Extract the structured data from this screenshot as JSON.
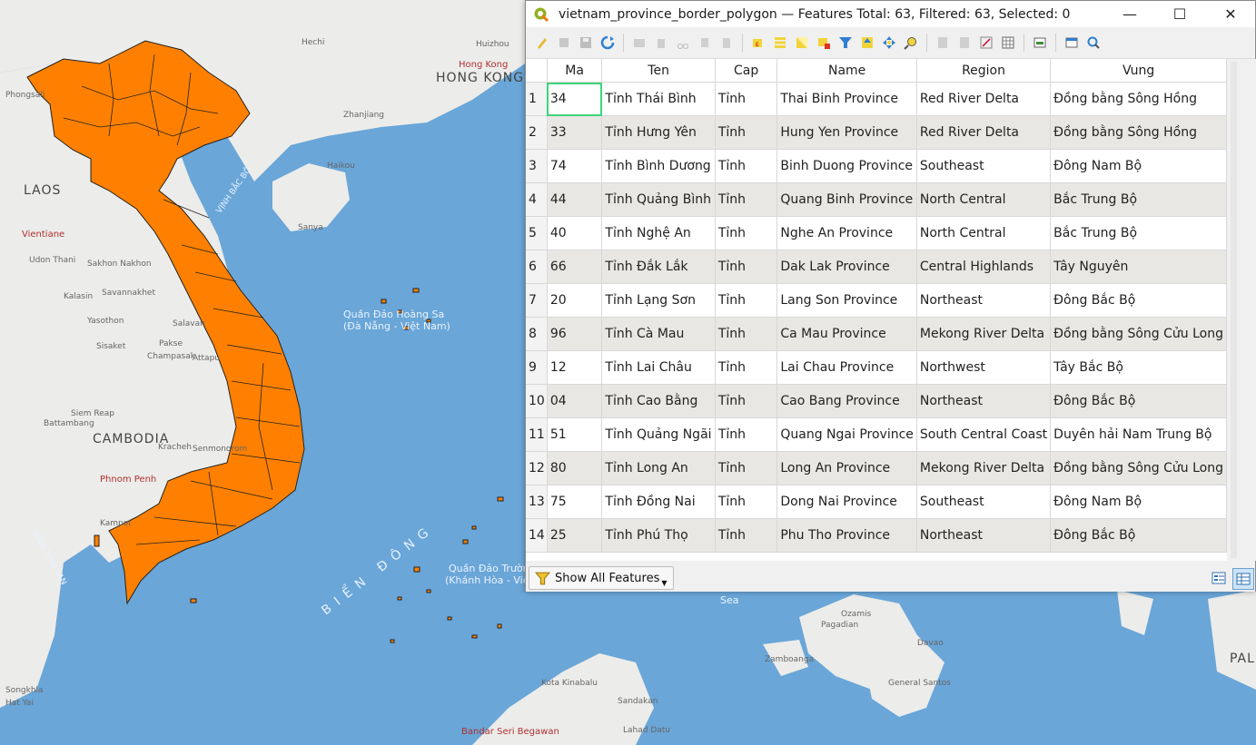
{
  "map": {
    "labels": {
      "laos": "LAOS",
      "cambodia": "CAMBODIA",
      "hong_kong": "HONG KONG",
      "vientiane": "Vientiane",
      "phnom_penh": "Phnom Penh",
      "hong_kong_small": "Hong Kong",
      "bandar": "Bandar Seri Begawan",
      "paracel": "Quần Đảo Hoàng Sa",
      "paracel_sub": "(Đà Nẵng - Việt Nam)",
      "spratly": "Quần Đảo Trường Sa",
      "spratly_sub": "(Khánh Hòa - Việt Nam)",
      "bien_dong": "BIỂN ĐÔNG",
      "vinh_bac_bo": "VỊNH BẮC BỘ",
      "vinh_thai_lan": "VỊNH THÁI LAN",
      "sea": "Sea",
      "pal": "PAL",
      "udon": "Udon Thani",
      "sakhon": "Sakhon Nakhon",
      "kalasin": "Kalasin",
      "savannakhet": "Savannakhet",
      "yasothon": "Yasothon",
      "sisaket": "Sisaket",
      "pakse": "Pakse",
      "champasak": "Champasak",
      "attapu": "Attapu",
      "salavan": "Salavan",
      "siem_reap": "Siem Reap",
      "battambang": "Battambang",
      "kracheh": "Kracheh",
      "senmonorom": "Senmonorom",
      "kampot": "Kampot",
      "phongsali": "Phongsali",
      "hechi": "Hechi",
      "huizhou": "Huizhou",
      "haikou": "Haikou",
      "sanya": "Sanya",
      "zhanjiang": "Zhanjiang",
      "zamboanga": "Zamboanga",
      "general_santos": "General Santos",
      "pagadian": "Pagadian",
      "ozamis": "Ozamis",
      "davao": "Davao",
      "kota_kinabalu": "Kota Kinabalu",
      "lahad_datu": "Lahad Datu",
      "sandakan": "Sandakan",
      "songkhla": "Songkhla",
      "hat_yai": "Hat Yai"
    }
  },
  "window": {
    "title": "vietnam_province_border_polygon — Features Total: 63, Filtered: 63, Selected: 0",
    "minimize": "—",
    "maximize": "☐",
    "close": "✕"
  },
  "table": {
    "columns": [
      "Ma",
      "Ten",
      "Cap",
      "Name",
      "Region",
      "Vung"
    ],
    "rows": [
      {
        "n": "1",
        "Ma": "34",
        "Ten": "Tỉnh Thái Bình",
        "Cap": "Tỉnh",
        "Name": "Thai Binh Province",
        "Region": "Red River Delta",
        "Vung": "Đồng bằng Sông Hồng"
      },
      {
        "n": "2",
        "Ma": "33",
        "Ten": "Tỉnh Hưng Yên",
        "Cap": "Tỉnh",
        "Name": "Hung Yen Province",
        "Region": "Red River Delta",
        "Vung": "Đồng bằng Sông Hồng"
      },
      {
        "n": "3",
        "Ma": "74",
        "Ten": "Tỉnh Bình Dương",
        "Cap": "Tỉnh",
        "Name": "Binh Duong Province",
        "Region": "Southeast",
        "Vung": "Đông Nam Bộ"
      },
      {
        "n": "4",
        "Ma": "44",
        "Ten": "Tỉnh Quảng Bình",
        "Cap": "Tỉnh",
        "Name": "Quang Binh Province",
        "Region": "North Central",
        "Vung": "Bắc Trung Bộ"
      },
      {
        "n": "5",
        "Ma": "40",
        "Ten": "Tỉnh Nghệ An",
        "Cap": "Tỉnh",
        "Name": "Nghe An Province",
        "Region": "North Central",
        "Vung": "Bắc Trung Bộ"
      },
      {
        "n": "6",
        "Ma": "66",
        "Ten": "Tỉnh Đắk Lắk",
        "Cap": "Tỉnh",
        "Name": "Dak Lak Province",
        "Region": "Central Highlands",
        "Vung": "Tây Nguyên"
      },
      {
        "n": "7",
        "Ma": "20",
        "Ten": "Tỉnh Lạng Sơn",
        "Cap": "Tỉnh",
        "Name": "Lang Son Province",
        "Region": "Northeast",
        "Vung": "Đông Bắc Bộ"
      },
      {
        "n": "8",
        "Ma": "96",
        "Ten": "Tỉnh Cà Mau",
        "Cap": "Tỉnh",
        "Name": "Ca Mau Province",
        "Region": "Mekong River Delta",
        "Vung": "Đồng bằng Sông Cửu Long"
      },
      {
        "n": "9",
        "Ma": "12",
        "Ten": "Tỉnh Lai Châu",
        "Cap": "Tỉnh",
        "Name": "Lai Chau Province",
        "Region": "Northwest",
        "Vung": "Tây Bắc Bộ"
      },
      {
        "n": "10",
        "Ma": "04",
        "Ten": "Tỉnh Cao Bằng",
        "Cap": "Tỉnh",
        "Name": "Cao Bang Province",
        "Region": "Northeast",
        "Vung": "Đông Bắc Bộ"
      },
      {
        "n": "11",
        "Ma": "51",
        "Ten": "Tỉnh Quảng Ngãi",
        "Cap": "Tỉnh",
        "Name": "Quang Ngai Province",
        "Region": "South Central Coast",
        "Vung": "Duyên hải Nam Trung Bộ"
      },
      {
        "n": "12",
        "Ma": "80",
        "Ten": "Tỉnh Long An",
        "Cap": "Tỉnh",
        "Name": "Long An Province",
        "Region": "Mekong River Delta",
        "Vung": "Đồng bằng Sông Cửu Long"
      },
      {
        "n": "13",
        "Ma": "75",
        "Ten": "Tỉnh Đồng Nai",
        "Cap": "Tỉnh",
        "Name": "Dong Nai Province",
        "Region": "Southeast",
        "Vung": "Đông Nam Bộ"
      },
      {
        "n": "14",
        "Ma": "25",
        "Ten": "Tỉnh Phú Thọ",
        "Cap": "Tỉnh",
        "Name": "Phu Tho Province",
        "Region": "Northeast",
        "Vung": "Đông Bắc Bộ"
      }
    ]
  },
  "bottom": {
    "show_all": "Show All Features"
  },
  "colors": {
    "vietnam_fill": "#ff8000",
    "sea": "#6aa6d8",
    "land": "#ececea",
    "selection": "#3ed47b"
  }
}
